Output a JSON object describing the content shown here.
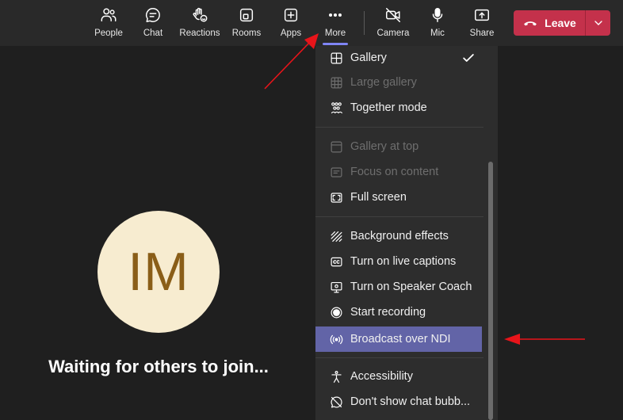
{
  "toolbar": {
    "people": "People",
    "chat": "Chat",
    "reactions": "Reactions",
    "rooms": "Rooms",
    "apps": "Apps",
    "more": "More",
    "camera": "Camera",
    "mic": "Mic",
    "share": "Share",
    "leave": "Leave"
  },
  "participant": {
    "initials": "IM",
    "status": "Waiting for others to join..."
  },
  "menu": {
    "items": [
      {
        "label": "Gallery",
        "icon": "grid-icon",
        "state": "checked"
      },
      {
        "label": "Large gallery",
        "icon": "large-grid-icon",
        "state": "disabled"
      },
      {
        "label": "Together mode",
        "icon": "together-mode-icon",
        "state": "enabled"
      },
      {
        "label": "Gallery at top",
        "icon": "gallery-top-icon",
        "state": "disabled"
      },
      {
        "label": "Focus on content",
        "icon": "focus-content-icon",
        "state": "disabled"
      },
      {
        "label": "Full screen",
        "icon": "fullscreen-icon",
        "state": "enabled"
      },
      {
        "label": "Background effects",
        "icon": "background-effects-icon",
        "state": "enabled"
      },
      {
        "label": "Turn on live captions",
        "icon": "captions-icon",
        "state": "enabled"
      },
      {
        "label": "Turn on Speaker Coach",
        "icon": "speaker-coach-icon",
        "state": "enabled"
      },
      {
        "label": "Start recording",
        "icon": "record-icon",
        "state": "enabled"
      },
      {
        "label": "Broadcast over NDI",
        "icon": "broadcast-icon",
        "state": "highlighted"
      },
      {
        "label": "Accessibility",
        "icon": "accessibility-icon",
        "state": "enabled"
      },
      {
        "label": "Don't show chat bubb...",
        "icon": "chat-bubble-off-icon",
        "state": "enabled"
      }
    ]
  },
  "colors": {
    "accent": "#6264a7",
    "leave": "#c4314b",
    "annotation": "#e8141a",
    "avatar_bg": "#f7ecd0",
    "avatar_text": "#8a5e18"
  }
}
